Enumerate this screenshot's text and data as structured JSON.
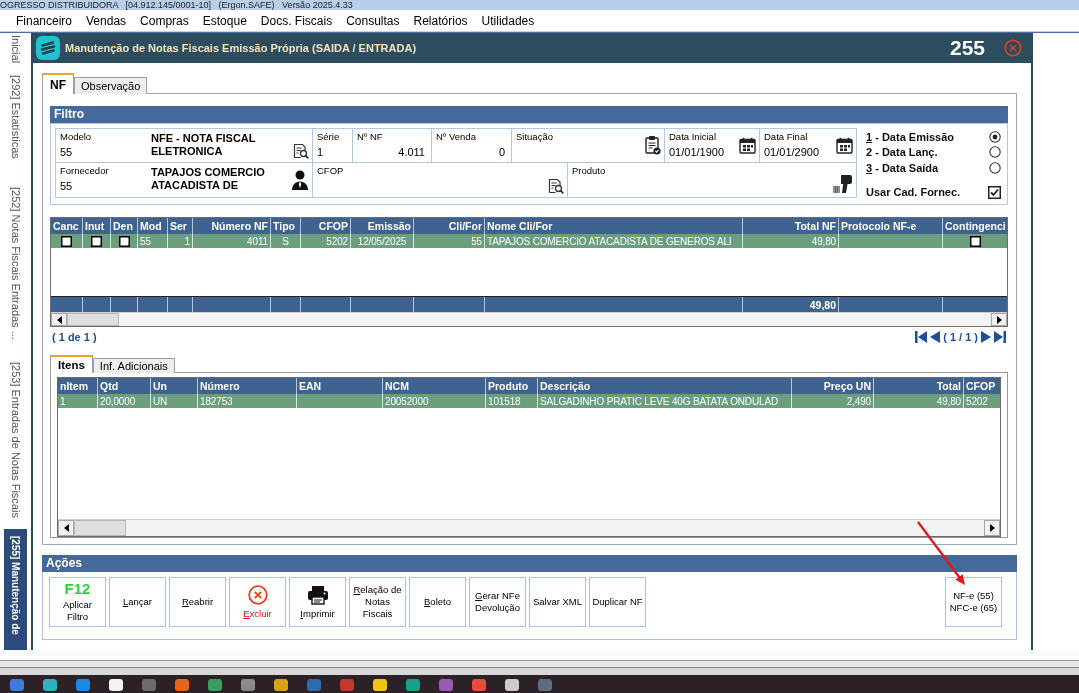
{
  "app_title": "OGRESSO DISTRIBUIDORA   [04.912.145/0001-10]   (Ergon.SAFE)   Versão 2025.4.33",
  "menu": [
    "Financeiro",
    "Vendas",
    "Compras",
    "Estoque",
    "Docs. Fiscais",
    "Consultas",
    "Relatórios",
    "Utilidades"
  ],
  "sidebar": {
    "tabs": [
      {
        "label": "Inicial",
        "selected": false
      },
      {
        "label": "[292] Estatísticas",
        "selected": false
      },
      {
        "label": "[252] Notas Fiscais Entradas ...",
        "selected": false
      },
      {
        "label": "[253] Entradas de Notas Fiscais",
        "selected": false
      },
      {
        "label": "[255] Manutenção de",
        "selected": true
      }
    ]
  },
  "window": {
    "title": "Manutenção de Notas Fiscais Emissão Própria (SAIDA / ENTRADA)",
    "number": "255"
  },
  "tabs": [
    {
      "label": "NF",
      "selected": true
    },
    {
      "label": "Observação",
      "selected": false
    }
  ],
  "filter": {
    "title": "Filtro",
    "rows": [
      [
        {
          "label": "Modelo",
          "kind": "model",
          "value": "55",
          "description": "NFE - NOTA FISCAL ELETRONICA"
        },
        {
          "label": "Série",
          "kind": "text",
          "value": "1"
        },
        {
          "label": "Nº NF",
          "kind": "number",
          "value": "4.011"
        },
        {
          "label": "Nº Venda",
          "kind": "number",
          "value": "0"
        },
        {
          "label": "Situação",
          "kind": "status"
        },
        {
          "label": "Data Inicial",
          "kind": "date",
          "value": "01/01/1900"
        },
        {
          "label": "Data Final",
          "kind": "date",
          "value": "01/01/2900"
        }
      ],
      [
        {
          "label": "Fornecedor",
          "kind": "supplier",
          "value": "55",
          "description": "TAPAJOS COMERCIO ATACADISTA DE"
        },
        {
          "label": "CFOP",
          "kind": "lookup"
        },
        {
          "label": "Produto",
          "kind": "product"
        }
      ]
    ],
    "date_options": [
      {
        "label": "1 - Data Emissão",
        "accelerator": true,
        "selected": true
      },
      {
        "label": "2 - Data Lanç.",
        "accelerator": false,
        "selected": false
      },
      {
        "label": "3 - Data Saída",
        "accelerator": true,
        "selected": false
      }
    ],
    "supplier_option": {
      "label": "Usar Cad. Fornec.",
      "checked": true
    }
  },
  "nf_table": {
    "columns": [
      "Canc",
      "Inut",
      "Den",
      "Mod",
      "Ser",
      "Número NF",
      "Tipo",
      "CFOP",
      "Emissão",
      "Cli/For",
      "Nome Cli/For",
      "Total NF",
      "Protocolo NF-e",
      "Contingenci"
    ],
    "rows": [
      {
        "selected": true,
        "cells": [
          {
            "checked": false
          },
          {
            "checked": false
          },
          {
            "checked": false
          },
          "55",
          "1",
          "4011",
          "S",
          "5202",
          "12/05/2025",
          "55",
          "TAPAJOS COMERCIO ATACADISTA DE GENEROS ALI",
          "49,80",
          null,
          {
            "checked": false
          }
        ]
      }
    ],
    "total": "49,80",
    "count": "( 1 de 1 )",
    "page": "( 1 / 1 )"
  },
  "item_tabs": [
    {
      "label": "Itens",
      "selected": true
    },
    {
      "label": "Inf. Adicionais",
      "selected": false
    }
  ],
  "items_table": {
    "columns": [
      "nItem",
      "Qtd",
      "Un",
      "Número",
      "EAN",
      "NCM",
      "Produto",
      "Descrição",
      "Preço UN",
      "Total",
      "CFOP"
    ],
    "rows": [
      {
        "selected": true,
        "cells": [
          "1",
          "20,0000",
          "UN",
          "182753",
          null,
          "20052000",
          "101518",
          "SALGADINHO PRATIC LEVE 40G BATATA ONDULAD",
          "2,490",
          "49,80",
          "5202"
        ]
      }
    ]
  },
  "actions": {
    "title": "Ações",
    "buttons": [
      {
        "label": "Aplicar Filtro",
        "kind": "hotkey",
        "hotkey": "F12",
        "accelerator": false
      },
      {
        "label": "Lançar",
        "kind": "text",
        "accelerator": true
      },
      {
        "label": "Reabrir",
        "kind": "text",
        "accelerator": true
      },
      {
        "label": "Excluir",
        "kind": "delete",
        "accelerator": true
      },
      {
        "label": "Imprimir",
        "kind": "print",
        "accelerator": true
      },
      {
        "label": "Relação de Notas Fiscais",
        "kind": "text",
        "accelerator": true
      },
      {
        "label": "Boleto",
        "kind": "text",
        "accelerator": true
      },
      {
        "label": "Gerar NFe Devolução",
        "kind": "text",
        "accelerator": true
      },
      {
        "label": "Salvar XML",
        "kind": "text",
        "accelerator": false
      },
      {
        "label": "Duplicar NF",
        "kind": "text",
        "accelerator": false
      }
    ],
    "model_button": [
      "NF-e (55)",
      "NFC-e (65)"
    ]
  }
}
